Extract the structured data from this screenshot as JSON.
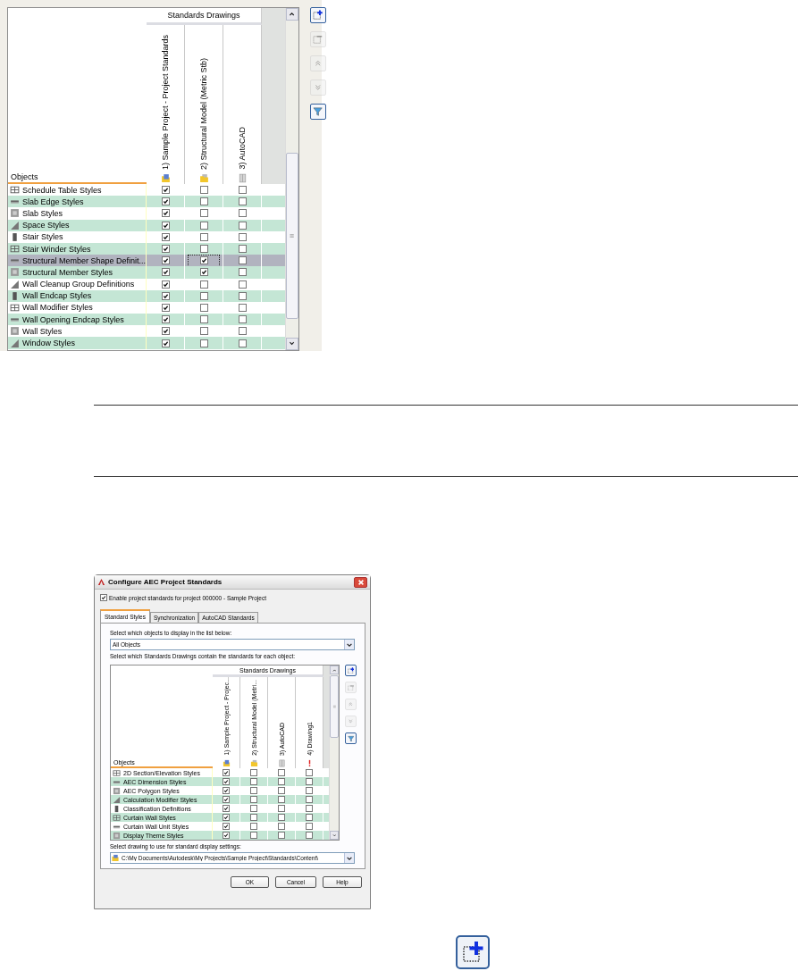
{
  "top_panel": {
    "grid": {
      "group_header": "Standards Drawings",
      "objects_label": "Objects",
      "columns": [
        {
          "label": "1) Sample Project - Project Standards",
          "kind": "project"
        },
        {
          "label": "2) Structural Model (Metric Stb)",
          "kind": "drawing"
        },
        {
          "label": "3) AutoCAD",
          "kind": "autocad"
        }
      ],
      "rows": [
        {
          "name": "Schedule Table Styles",
          "selected": false,
          "cells": [
            {
              "checked": true,
              "focused": false
            },
            {
              "checked": false,
              "focused": false
            },
            {
              "checked": false,
              "focused": false
            }
          ]
        },
        {
          "name": "Slab Edge Styles",
          "selected": false,
          "cells": [
            {
              "checked": true,
              "focused": false
            },
            {
              "checked": false,
              "focused": false
            },
            {
              "checked": false,
              "focused": false
            }
          ]
        },
        {
          "name": "Slab Styles",
          "selected": false,
          "cells": [
            {
              "checked": true,
              "focused": false
            },
            {
              "checked": false,
              "focused": false
            },
            {
              "checked": false,
              "focused": false
            }
          ]
        },
        {
          "name": "Space Styles",
          "selected": false,
          "cells": [
            {
              "checked": true,
              "focused": false
            },
            {
              "checked": false,
              "focused": false
            },
            {
              "checked": false,
              "focused": false
            }
          ]
        },
        {
          "name": "Stair Styles",
          "selected": false,
          "cells": [
            {
              "checked": true,
              "focused": false
            },
            {
              "checked": false,
              "focused": false
            },
            {
              "checked": false,
              "focused": false
            }
          ]
        },
        {
          "name": "Stair Winder Styles",
          "selected": false,
          "cells": [
            {
              "checked": true,
              "focused": false
            },
            {
              "checked": false,
              "focused": false
            },
            {
              "checked": false,
              "focused": false
            }
          ]
        },
        {
          "name": "Structural Member Shape Definit...",
          "selected": true,
          "cells": [
            {
              "checked": true,
              "focused": false
            },
            {
              "checked": true,
              "focused": true
            },
            {
              "checked": false,
              "focused": false
            }
          ]
        },
        {
          "name": "Structural Member Styles",
          "selected": false,
          "cells": [
            {
              "checked": true,
              "focused": false
            },
            {
              "checked": true,
              "focused": false
            },
            {
              "checked": false,
              "focused": false
            }
          ]
        },
        {
          "name": "Wall Cleanup Group Definitions",
          "selected": false,
          "cells": [
            {
              "checked": true,
              "focused": false
            },
            {
              "checked": false,
              "focused": false
            },
            {
              "checked": false,
              "focused": false
            }
          ]
        },
        {
          "name": "Wall Endcap Styles",
          "selected": false,
          "cells": [
            {
              "checked": true,
              "focused": false
            },
            {
              "checked": false,
              "focused": false
            },
            {
              "checked": false,
              "focused": false
            }
          ]
        },
        {
          "name": "Wall Modifier Styles",
          "selected": false,
          "cells": [
            {
              "checked": true,
              "focused": false
            },
            {
              "checked": false,
              "focused": false
            },
            {
              "checked": false,
              "focused": false
            }
          ]
        },
        {
          "name": "Wall Opening Endcap Styles",
          "selected": false,
          "cells": [
            {
              "checked": true,
              "focused": false
            },
            {
              "checked": false,
              "focused": false
            },
            {
              "checked": false,
              "focused": false
            }
          ]
        },
        {
          "name": "Wall Styles",
          "selected": false,
          "cells": [
            {
              "checked": true,
              "focused": false
            },
            {
              "checked": false,
              "focused": false
            },
            {
              "checked": false,
              "focused": false
            }
          ]
        },
        {
          "name": "Window Styles",
          "selected": false,
          "cells": [
            {
              "checked": true,
              "focused": false
            },
            {
              "checked": false,
              "focused": false
            },
            {
              "checked": false,
              "focused": false
            }
          ]
        }
      ]
    },
    "tool_buttons": [
      {
        "kind": "add",
        "disabled": false
      },
      {
        "kind": "remove",
        "disabled": true
      },
      {
        "kind": "up",
        "disabled": true
      },
      {
        "kind": "down",
        "disabled": true
      },
      {
        "kind": "filter",
        "disabled": false
      }
    ]
  },
  "dialog": {
    "title": "Configure AEC Project Standards",
    "enable": {
      "label": "Enable project standards for project 000000 - Sample Project",
      "checked": true
    },
    "tabs": [
      {
        "label": "Standard Styles",
        "selected": true
      },
      {
        "label": "Synchronization",
        "selected": false
      },
      {
        "label": "AutoCAD Standards",
        "selected": false
      }
    ],
    "objects_prompt": "Select which objects to display in the list below:",
    "objects_dropdown": "All Objects",
    "drawings_prompt": "Select which Standards Drawings contain the standards for each object:",
    "grid": {
      "group_header": "Standards Drawings",
      "objects_label": "Objects",
      "columns": [
        {
          "label": "1) Sample Project - Projec...",
          "kind": "project"
        },
        {
          "label": "2) Structural Model (Metri...",
          "kind": "drawing"
        },
        {
          "label": "3) AutoCAD",
          "kind": "autocad"
        },
        {
          "label": "4) Drawing1",
          "kind": "missing"
        }
      ],
      "rows": [
        {
          "name": "2D Section/Elevation Styles",
          "selected": false,
          "cells": [
            {
              "checked": true,
              "focused": false
            },
            {
              "checked": false,
              "focused": false
            },
            {
              "checked": false,
              "focused": false
            },
            {
              "checked": false,
              "focused": false
            }
          ]
        },
        {
          "name": "AEC Dimension Styles",
          "selected": false,
          "cells": [
            {
              "checked": true,
              "focused": false
            },
            {
              "checked": false,
              "focused": false
            },
            {
              "checked": false,
              "focused": false
            },
            {
              "checked": false,
              "focused": false
            }
          ]
        },
        {
          "name": "AEC Polygon Styles",
          "selected": false,
          "cells": [
            {
              "checked": true,
              "focused": false
            },
            {
              "checked": false,
              "focused": false
            },
            {
              "checked": false,
              "focused": false
            },
            {
              "checked": false,
              "focused": false
            }
          ]
        },
        {
          "name": "Calculation Modifier Styles",
          "selected": false,
          "cells": [
            {
              "checked": true,
              "focused": false
            },
            {
              "checked": false,
              "focused": false
            },
            {
              "checked": false,
              "focused": false
            },
            {
              "checked": false,
              "focused": false
            }
          ]
        },
        {
          "name": "Classification Definitions",
          "selected": false,
          "cells": [
            {
              "checked": true,
              "focused": false
            },
            {
              "checked": false,
              "focused": false
            },
            {
              "checked": false,
              "focused": false
            },
            {
              "checked": false,
              "focused": false
            }
          ]
        },
        {
          "name": "Curtain Wall Styles",
          "selected": false,
          "cells": [
            {
              "checked": true,
              "focused": false
            },
            {
              "checked": false,
              "focused": false
            },
            {
              "checked": false,
              "focused": false
            },
            {
              "checked": false,
              "focused": false
            }
          ]
        },
        {
          "name": "Curtain Wall Unit Styles",
          "selected": false,
          "cells": [
            {
              "checked": true,
              "focused": false
            },
            {
              "checked": false,
              "focused": false
            },
            {
              "checked": false,
              "focused": false
            },
            {
              "checked": false,
              "focused": false
            }
          ]
        },
        {
          "name": "Display Theme Styles",
          "selected": false,
          "cells": [
            {
              "checked": true,
              "focused": false
            },
            {
              "checked": false,
              "focused": false
            },
            {
              "checked": false,
              "focused": false
            },
            {
              "checked": false,
              "focused": false
            }
          ]
        }
      ]
    },
    "tool_buttons": [
      {
        "kind": "add",
        "disabled": false
      },
      {
        "kind": "remove",
        "disabled": true
      },
      {
        "kind": "up",
        "disabled": true
      },
      {
        "kind": "down",
        "disabled": true
      },
      {
        "kind": "filter",
        "disabled": false
      }
    ],
    "display_prompt": "Select drawing to use for standard display settings:",
    "display_path": "C:\\My Documents\\Autodesk\\My Projects\\Sample Project\\Standards\\Content\\",
    "buttons": [
      "OK",
      "Cancel",
      "Help"
    ]
  }
}
